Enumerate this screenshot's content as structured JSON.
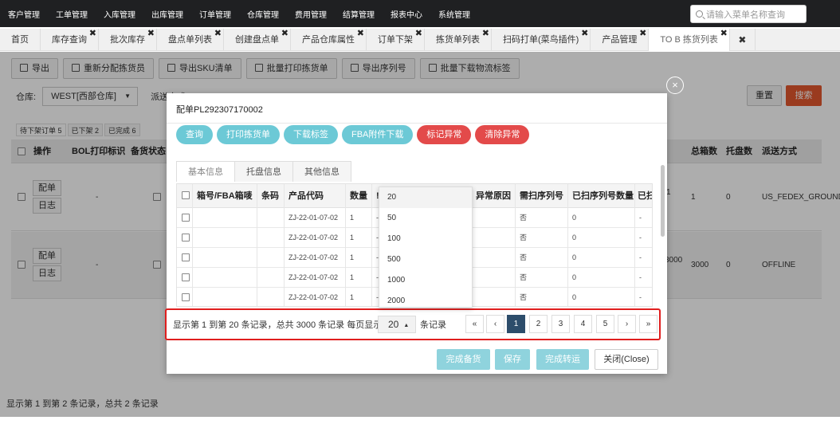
{
  "topnav": {
    "items": [
      "客户管理",
      "工单管理",
      "入库管理",
      "出库管理",
      "订单管理",
      "仓库管理",
      "费用管理",
      "结算管理",
      "报表中心",
      "系统管理"
    ],
    "search_placeholder": "请输入菜单名称查询"
  },
  "tabs": [
    {
      "label": "首页",
      "closable": false
    },
    {
      "label": "库存查询",
      "closable": true
    },
    {
      "label": "批次库存",
      "closable": true
    },
    {
      "label": "盘点单列表",
      "closable": true
    },
    {
      "label": "创建盘点单",
      "closable": true
    },
    {
      "label": "产品仓库属性",
      "closable": true
    },
    {
      "label": "订单下架",
      "closable": true
    },
    {
      "label": "拣货单列表",
      "closable": true
    },
    {
      "label": "扫码打单(菜鸟插件)",
      "closable": true
    },
    {
      "label": "产品管理",
      "closable": true
    },
    {
      "label": "TO B 拣货列表",
      "closable": true,
      "active": true
    }
  ],
  "tab_close_all": "✖",
  "toolbar": [
    "导出",
    "重新分配拣货员",
    "导出SKU清单",
    "批量打印拣货单",
    "导出序列号",
    "批量下载物流标签"
  ],
  "filter": {
    "warehouse_label": "仓库:",
    "warehouse_value": "WEST[西部仓库]",
    "ship_label": "派送方式",
    "reset": "重置",
    "search": "搜索"
  },
  "subtabs": [
    "待下架订单 5",
    "已下架 2",
    "已完成 6"
  ],
  "grid": {
    "headers": [
      "操作",
      "BOL打印标识",
      "备货状态",
      "总箱数",
      "托盘数",
      "派送方式"
    ],
    "rows": [
      {
        "btn1": "配单",
        "btn2": "日志",
        "bol": "-",
        "extra": "1",
        "boxes": "1",
        "pallets": "0",
        "ship": "US_FEDEX_GROUND"
      },
      {
        "btn1": "配单",
        "btn2": "日志",
        "bol": "-",
        "extra": "3000",
        "boxes": "3000",
        "pallets": "0",
        "ship": "OFFLINE"
      }
    ],
    "footer": "显示第 1 到第 2 条记录，总共 2 条记录"
  },
  "modal": {
    "title": "配单PL292307170002",
    "actions": [
      "查询",
      "打印拣货单",
      "下载标签",
      "FBA附件下载"
    ],
    "danger_actions": [
      "标记异常",
      "清除异常"
    ],
    "tabs": [
      "基本信息",
      "托盘信息",
      "其他信息"
    ],
    "table_headers": [
      "箱号/FBA箱唛",
      "条码",
      "产品代码",
      "数量",
      "!",
      "异常原因",
      "需扫序列号",
      "已扫序列号数量",
      "已扫"
    ],
    "rows": [
      {
        "code": "ZJ-22-01-07-02",
        "qty": "1",
        "dash": "-",
        "scan": "否",
        "scanned": "0",
        "last": "-"
      },
      {
        "code": "ZJ-22-01-07-02",
        "qty": "1",
        "dash": "-",
        "scan": "否",
        "scanned": "0",
        "last": "-"
      },
      {
        "code": "ZJ-22-01-07-02",
        "qty": "1",
        "dash": "-",
        "scan": "否",
        "scanned": "0",
        "last": "-"
      },
      {
        "code": "ZJ-22-01-07-02",
        "qty": "1",
        "dash": "-",
        "scan": "否",
        "scanned": "0",
        "last": "-"
      },
      {
        "code": "ZJ-22-01-07-02",
        "qty": "1",
        "dash": "-",
        "scan": "否",
        "scanned": "0",
        "last": "-"
      }
    ],
    "pager": {
      "text": "显示第 1 到第 20 条记录，总共 3000 条记录 每页显示",
      "page_size": "20",
      "suffix": "条记录",
      "first": "«",
      "prev": "‹",
      "pages": [
        "1",
        "2",
        "3",
        "4",
        "5"
      ],
      "next": "›",
      "last": "»"
    },
    "page_size_options": [
      "20",
      "50",
      "100",
      "500",
      "1000",
      "2000"
    ],
    "footer_buttons": [
      "完成备货",
      "保存",
      "完成转运"
    ],
    "close_label": "关闭(Close)",
    "close_icon": "×"
  }
}
